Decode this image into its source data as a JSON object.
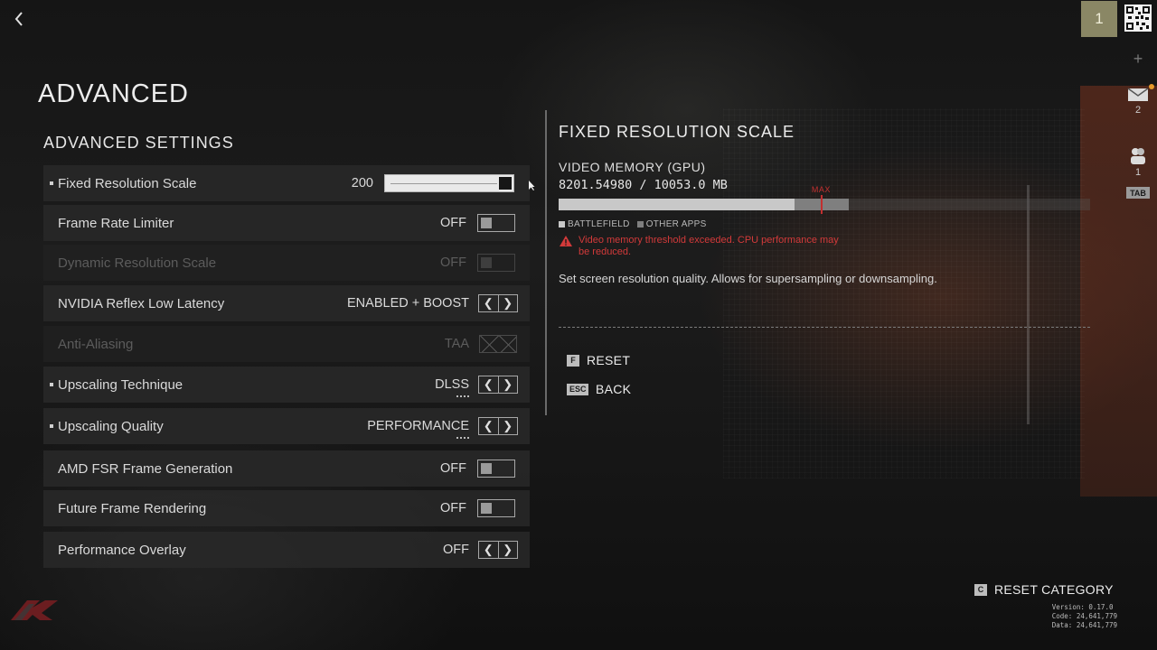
{
  "header": {
    "page_title": "ADVANCED",
    "player_number": "1",
    "mail_count": "2",
    "friends_count": "1",
    "tab_key": "TAB"
  },
  "settings": {
    "section_title": "ADVANCED SETTINGS",
    "rows": [
      {
        "label": "Fixed Resolution Scale",
        "value": "200",
        "control": "slider",
        "slider_level": 1.0,
        "marked": true,
        "enabled": true
      },
      {
        "label": "Frame Rate Limiter",
        "value": "OFF",
        "control": "toggle",
        "marked": false,
        "enabled": true
      },
      {
        "label": "Dynamic Resolution Scale",
        "value": "OFF",
        "control": "toggle",
        "marked": false,
        "enabled": false
      },
      {
        "label": "NVIDIA Reflex Low Latency",
        "value": "ENABLED + BOOST",
        "control": "arrows",
        "marked": false,
        "enabled": true
      },
      {
        "label": "Anti-Aliasing",
        "value": "TAA",
        "control": "locked",
        "marked": false,
        "enabled": false
      },
      {
        "label": "Upscaling Technique",
        "value": "DLSS",
        "control": "arrows",
        "marked": true,
        "enabled": true
      },
      {
        "label": "Upscaling Quality",
        "value": "PERFORMANCE",
        "control": "arrows",
        "marked": true,
        "enabled": true
      },
      {
        "label": "AMD FSR Frame Generation",
        "value": "OFF",
        "control": "toggle",
        "marked": false,
        "enabled": true
      },
      {
        "label": "Future Frame Rendering",
        "value": "OFF",
        "control": "toggle",
        "marked": false,
        "enabled": true
      },
      {
        "label": "Performance Overlay",
        "value": "OFF",
        "control": "arrows",
        "marked": false,
        "enabled": true
      }
    ]
  },
  "detail": {
    "title": "FIXED RESOLUTION SCALE",
    "vram_title": "VIDEO MEMORY (GPU)",
    "vram_value": "8201.54980 / 10053.0 MB",
    "vram_used_mb": 8201.5498,
    "vram_total_mb": 10053.0,
    "battlefield_fraction": 0.444,
    "other_apps_fraction": 0.102,
    "max_fraction": 0.493,
    "max_label": "MAX",
    "legend_battlefield": "BATTLEFIELD",
    "legend_other": "OTHER APPS",
    "warning": "Video memory threshold exceeded. CPU performance may be reduced.",
    "description": "Set screen resolution quality. Allows for supersampling or downsampling."
  },
  "actions": {
    "reset_key": "F",
    "reset_label": "RESET",
    "back_key": "ESC",
    "back_label": "BACK",
    "reset_category_key": "C",
    "reset_category_label": "RESET CATEGORY"
  },
  "version": {
    "version_line": "Version: 0.17.0",
    "code_line": "Code: 24,641,779",
    "data_line": "Data: 24,641,779"
  },
  "colors": {
    "warning_red": "#d23a3a",
    "panel_row": "#2a2a2a",
    "player_badge": "#8a8765",
    "memory_used": "#c8c8c8",
    "memory_other": "#7f7f7f"
  },
  "icons": {
    "back": "chevron-left-icon",
    "qr": "qr-code-icon",
    "add": "plus-icon",
    "mail": "mail-icon",
    "friends": "friends-icon",
    "warning": "warning-triangle-icon",
    "logo": "game-logo-icon"
  }
}
